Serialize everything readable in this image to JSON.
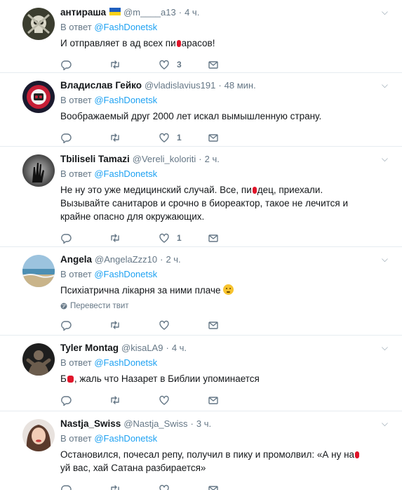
{
  "reply_prefix": "В ответ",
  "translate_label": "Перевести твит",
  "colors": {
    "link": "#1da1f2",
    "muted": "#657786",
    "border": "#e6ecf0",
    "redaction": "#e0162b"
  },
  "tweets": [
    {
      "name": "антираша",
      "handle": "@m____a13",
      "time": "4 ч.",
      "reply_to": "@FashDonetsk",
      "text_a": "И отправляет в ад всех пи",
      "text_b": "арасов!",
      "text_c": "",
      "likes": "3",
      "avatar_icon": "skull-avatar"
    },
    {
      "name": "Владислав Гейко",
      "handle": "@vladislavius191",
      "time": "48 мин.",
      "reply_to": "@FashDonetsk",
      "text_a": "Воображаемый друг 2000 лет искал вымышленную страну.",
      "likes": "1",
      "avatar_icon": "emblem-avatar"
    },
    {
      "name": "Tbiliseli Tamazi",
      "handle": "@Vereli_koloriti",
      "time": "2 ч.",
      "reply_to": "@FashDonetsk",
      "text_a": "Не ну это уже медицинский случай. Все, пи",
      "text_b": "дец, приехали. Вызывайте санитаров и срочно в биореактор, такое не лечится и крайне опасно для окружающих.",
      "likes": "1",
      "avatar_icon": "shadow-hand-avatar"
    },
    {
      "name": "Angela",
      "handle": "@AngelaZzz10",
      "time": "2 ч.",
      "reply_to": "@FashDonetsk",
      "text_a": "Психіатрична лікарня за ними плаче",
      "likes": "",
      "avatar_icon": "beach-avatar"
    },
    {
      "name": "Tyler Montag",
      "handle": "@kisaLA9",
      "time": "4 ч.",
      "reply_to": "@FashDonetsk",
      "text_a": "Б",
      "text_b": ", жаль что Назарет в Библии упоминается",
      "likes": "",
      "avatar_icon": "athlete-avatar"
    },
    {
      "name": "Nastja_Swiss",
      "handle": "@Nastja_Swiss",
      "time": "3 ч.",
      "reply_to": "@FashDonetsk",
      "text_a": "Остановился, почесал репу, получил в пику и промолвил: «А ну на",
      "text_b": "уй вас, хай Сатана разбирается»",
      "likes": "",
      "avatar_icon": "portrait-avatar"
    }
  ]
}
